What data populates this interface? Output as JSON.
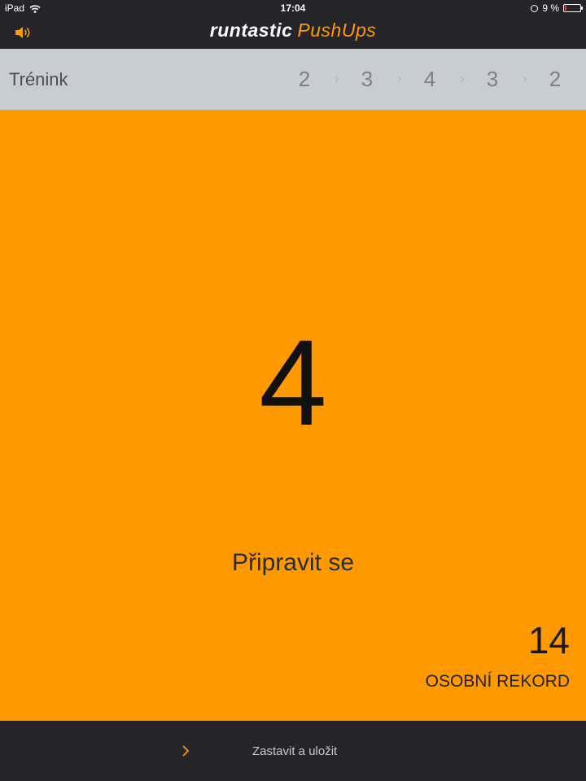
{
  "status_bar": {
    "device": "iPad",
    "time": "17:04",
    "battery_text": "9 %",
    "battery_level": 0.09,
    "icons": [
      "wifi-icon",
      "alarm-icon",
      "battery-icon"
    ]
  },
  "header": {
    "brand_main": "runtastic",
    "brand_sub": "PushUps",
    "sound_icon": "speaker-icon"
  },
  "training": {
    "label": "Trénink",
    "sets": [
      "2",
      "3",
      "4",
      "3",
      "2"
    ]
  },
  "main": {
    "countdown": "4",
    "message": "Připravit se"
  },
  "record": {
    "value": "14",
    "label": "OSOBNÍ REKORD"
  },
  "footer": {
    "stop_save_label": "Zastavit a uložit",
    "chevron_icon": "chevron-right-icon"
  },
  "colors": {
    "accent": "#ff9900",
    "dark": "#252429",
    "training_bar": "#c8cdd4",
    "battery_low": "#ff3b30"
  }
}
